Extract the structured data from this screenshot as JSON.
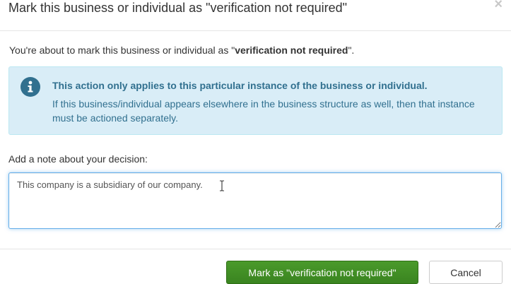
{
  "modal": {
    "title": "Mark this business or individual as \"verification not required\"",
    "close_glyph": "×",
    "intro": {
      "prefix": "You're about to mark this business or individual as \"",
      "bold": "verification not required",
      "suffix": "\"."
    },
    "alert": {
      "icon": "info-icon",
      "heading": "This action only applies to this particular instance of the business or individual.",
      "body": "If this business/individual appears elsewhere in the business structure as well, then that instance must be actioned separately."
    },
    "note": {
      "label": "Add a note about your decision:",
      "value": "This company is a subsidiary of our company."
    },
    "footer": {
      "confirm_label": "Mark as \"verification not required\"",
      "cancel_label": "Cancel"
    }
  },
  "colors": {
    "alert_bg": "#d9edf7",
    "alert_border": "#bce8f1",
    "alert_text": "#31708f",
    "primary_button": "#3d8b1f",
    "focus_border": "#66afe9"
  }
}
